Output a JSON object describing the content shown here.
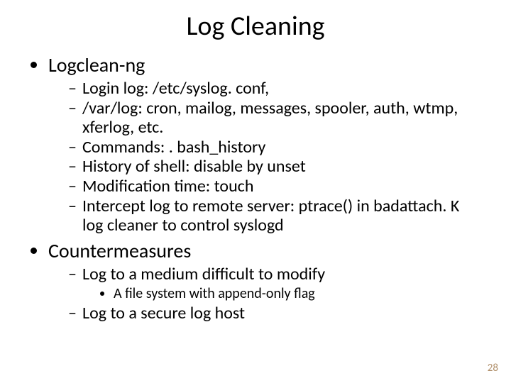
{
  "title": "Log Cleaning",
  "items": [
    {
      "label": "Logclean-ng",
      "sub": [
        "Login log: /etc/syslog. conf,",
        "/var/log: cron, mailog, messages, spooler, auth, wtmp, xferlog, etc.",
        "Commands: . bash_history",
        "History of shell: disable by unset",
        "Modification time: touch",
        "Intercept log to remote server: ptrace() in badattach. K log cleaner to control syslogd"
      ]
    },
    {
      "label": "Countermeasures",
      "sub": [
        "Log to a medium difficult to modify"
      ],
      "subsub_after_0": [
        "A file system with append-only flag"
      ],
      "sub_tail": [
        "Log to a secure log host"
      ]
    }
  ],
  "page_number": "28"
}
